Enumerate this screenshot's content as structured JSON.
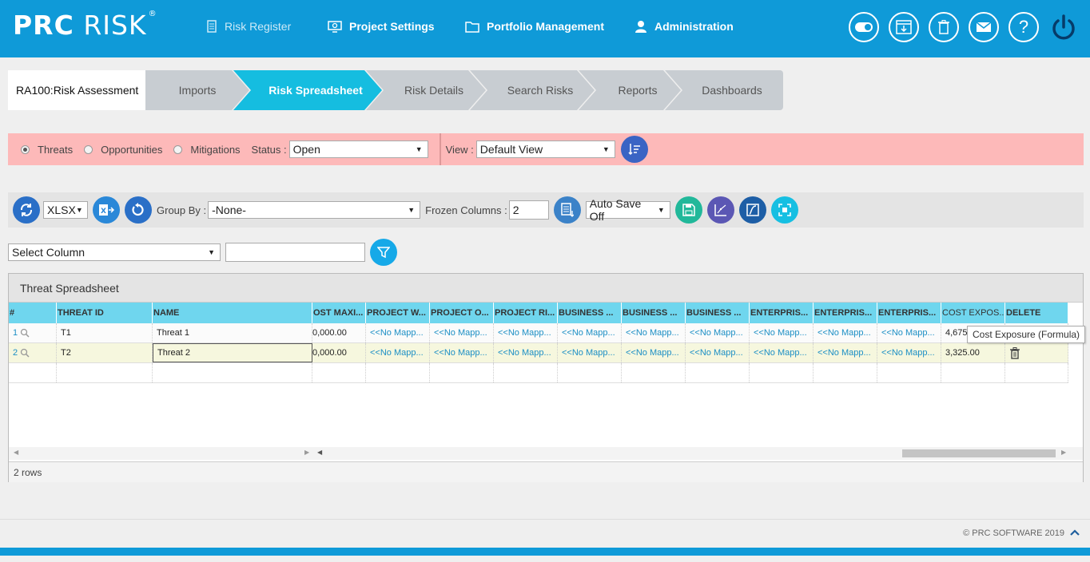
{
  "header": {
    "logo_text_bold": "PRC",
    "logo_text": "RISK",
    "logo_reg": "®",
    "nav": [
      {
        "label": "Risk Register"
      },
      {
        "label": "Project Settings"
      },
      {
        "label": "Portfolio Management"
      },
      {
        "label": "Administration"
      }
    ],
    "icons": [
      "toggle-icon",
      "download-window-icon",
      "trash-icon",
      "mail-icon",
      "help-icon",
      "power-icon"
    ]
  },
  "breadcrumb": {
    "current": "RA100:Risk Assessment",
    "tabs": [
      {
        "label": "Imports"
      },
      {
        "label": "Risk Spreadsheet"
      },
      {
        "label": "Risk Details"
      },
      {
        "label": "Search Risks"
      },
      {
        "label": "Reports"
      },
      {
        "label": "Dashboards"
      }
    ],
    "active_tab": "Risk Spreadsheet"
  },
  "filter": {
    "types": [
      "Threats",
      "Opportunities",
      "Mitigations"
    ],
    "selected_type": "Threats",
    "status_label": "Status :",
    "status_value": "Open",
    "view_label": "View :",
    "view_value": "Default View"
  },
  "toolbar": {
    "format_value": "XLSX",
    "group_by_label": "Group By :",
    "group_by_value": "-None-",
    "frozen_label": "Frozen Columns :",
    "frozen_value": "2",
    "autosave_value": "Auto Save Off"
  },
  "column_filter": {
    "select_value": "Select Column",
    "text_value": ""
  },
  "grid": {
    "title": "Threat Spreadsheet",
    "columns": [
      "#",
      "THREAT ID",
      "NAME",
      "OST MAXI...",
      "PROJECT W...",
      "PROJECT O...",
      "PROJECT RI...",
      "BUSINESS ...",
      "BUSINESS ...",
      "BUSINESS ...",
      "ENTERPRIS...",
      "ENTERPRIS...",
      "ENTERPRIS...",
      "COST EXPOS...",
      "DELETE"
    ],
    "rows": [
      {
        "num": "1",
        "id": "T1",
        "name": "Threat 1",
        "cost_max": "0,000.00",
        "mapped": "<<No Mapp...",
        "cost_exposure": "4,675"
      },
      {
        "num": "2",
        "id": "T2",
        "name": "Threat 2",
        "cost_max": "0,000.00",
        "mapped": "<<No Mapp...",
        "cost_exposure": "3,325.00"
      }
    ],
    "row_count": "2 rows",
    "tooltip": "Cost Exposure (Formula)"
  },
  "footer": {
    "copyright": "© PRC SOFTWARE 2019"
  },
  "colors": {
    "header_blue": "#0f9ad8",
    "active_tab": "#15bde0",
    "filter_bg": "#fdb9b9",
    "grid_header": "#6fd6ee"
  }
}
